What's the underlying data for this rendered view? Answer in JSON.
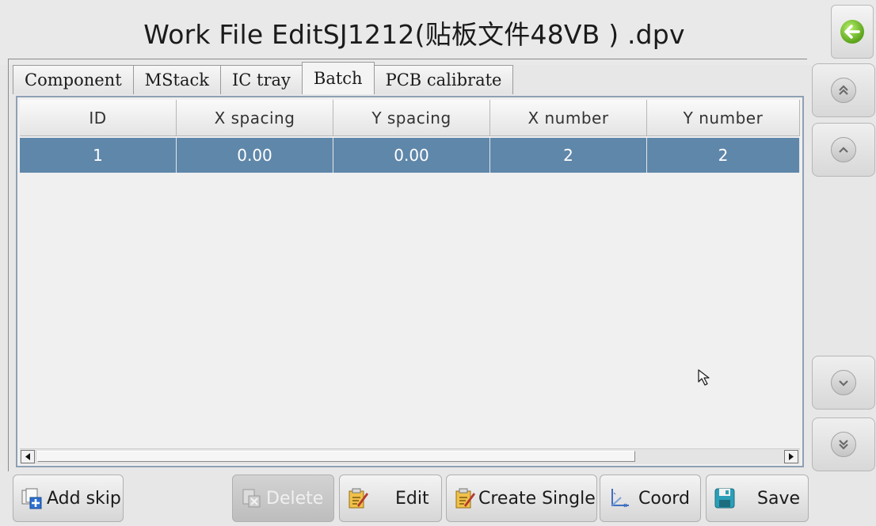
{
  "window": {
    "title": "Work File EditSJ1212(贴板文件48VB ) .dpv"
  },
  "tabs": [
    {
      "label": "Component",
      "active": false
    },
    {
      "label": "MStack",
      "active": false
    },
    {
      "label": "IC tray",
      "active": false
    },
    {
      "label": "Batch",
      "active": true
    },
    {
      "label": "PCB calibrate",
      "active": false
    }
  ],
  "table": {
    "columns": [
      "ID",
      "X spacing",
      "Y spacing",
      "X number",
      "Y number"
    ],
    "rows": [
      {
        "cells": [
          "1",
          "0.00",
          "0.00",
          "2",
          "2"
        ],
        "selected": true
      }
    ]
  },
  "toolbar": {
    "add_skip": "Add skip",
    "delete": "Delete",
    "edit": "Edit",
    "create_single": "Create Single",
    "coord": "Coord",
    "save": "Save"
  },
  "colors": {
    "selected_row": "#5f87aa",
    "table_border": "#8ea0b4",
    "back_icon": "#5aa31b"
  },
  "icons": {
    "back": "back-arrow-icon",
    "page_first": "double-chevron-up-icon",
    "page_up": "chevron-up-icon",
    "page_down": "chevron-down-icon",
    "page_last": "double-chevron-down-icon"
  }
}
